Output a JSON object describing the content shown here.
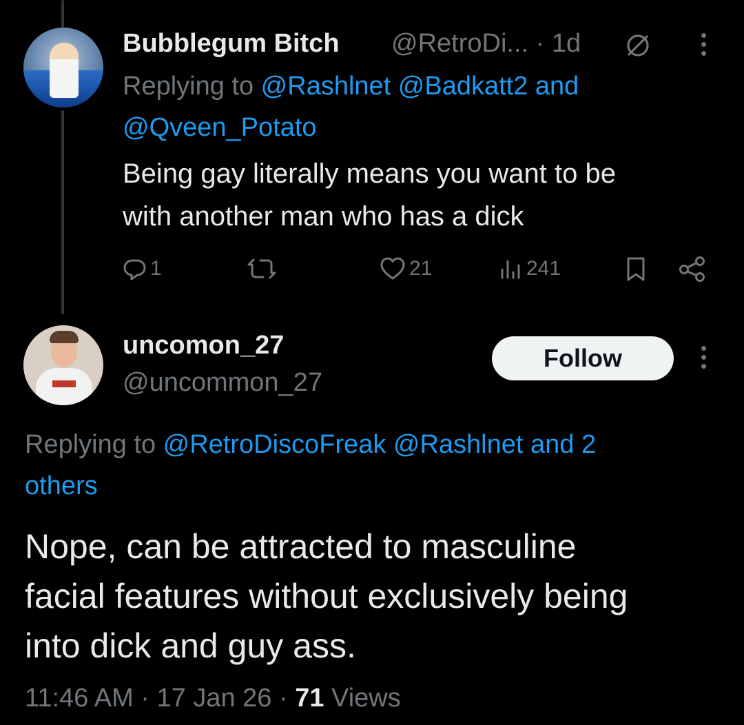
{
  "reply_tweet": {
    "display_name": "Bubblegum Bitch",
    "handle": "@RetroDi...",
    "time_sep": " · ",
    "time": "1d",
    "replying_prefix": "Replying to ",
    "replying_line1_mentions": "@Rashlnet @Badkatt2 and",
    "replying_line2_mentions": "@Qveen_Potato",
    "text_line1": "Being gay literally means you want to be",
    "text_line2": "with another man who has a dick",
    "replies": "1",
    "likes": "21",
    "views": "241"
  },
  "main_tweet": {
    "display_name": "uncomon_27",
    "handle": "@uncommon_27",
    "follow_label": "Follow",
    "replying_prefix": "Replying to ",
    "replying_line1_mentions": "@RetroDiscoFreak @Rashlnet and 2",
    "replying_line2_mentions": "others",
    "text_line1": "Nope, can be attracted to masculine",
    "text_line2": "facial features without exclusively being",
    "text_line3": "into dick and guy ass.",
    "time": "11:46 AM",
    "sep1": " · ",
    "date": "17 Jan 26",
    "sep2": " · ",
    "views_count": "71",
    "views_label": " Views"
  },
  "colors": {
    "background": "#000000",
    "primary_text": "#e7e9ea",
    "secondary_text": "#71767b",
    "link": "#1d9bf0",
    "follow_bg": "#eff3f4"
  },
  "icons": [
    "reply-icon",
    "retweet-icon",
    "like-icon",
    "views-icon",
    "bookmark-icon",
    "share-icon",
    "more-icon",
    "no-edit-icon"
  ]
}
